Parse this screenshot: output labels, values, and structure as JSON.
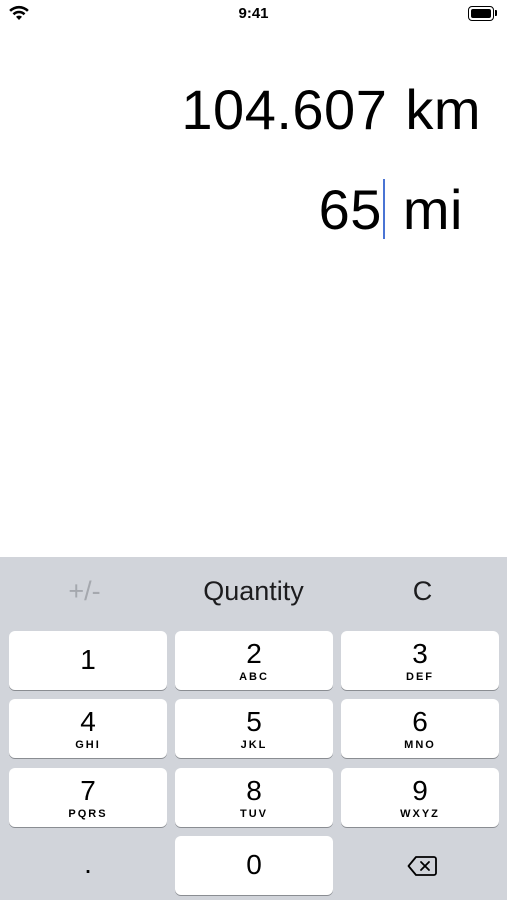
{
  "status_bar": {
    "time": "9:41",
    "wifi_icon": "wifi-icon",
    "battery_icon": "battery-icon"
  },
  "display": {
    "result_value": "104.607",
    "result_unit": "km",
    "input_value": "65",
    "input_unit": "mi"
  },
  "keyboard": {
    "top": {
      "plus_minus": "+/-",
      "quantity": "Quantity",
      "clear": "C"
    },
    "keys": [
      {
        "num": "1",
        "letters": ""
      },
      {
        "num": "2",
        "letters": "ABC"
      },
      {
        "num": "3",
        "letters": "DEF"
      },
      {
        "num": "4",
        "letters": "GHI"
      },
      {
        "num": "5",
        "letters": "JKL"
      },
      {
        "num": "6",
        "letters": "MNO"
      },
      {
        "num": "7",
        "letters": "PQRS"
      },
      {
        "num": "8",
        "letters": "TUV"
      },
      {
        "num": "9",
        "letters": "WXYZ"
      }
    ],
    "dot": ".",
    "zero": "0",
    "delete_icon": "delete-backspace-icon"
  },
  "colors": {
    "cursor": "#4a74d4",
    "keyboard_bg": "#d1d4da",
    "disabled_text": "#a5a8ae"
  }
}
